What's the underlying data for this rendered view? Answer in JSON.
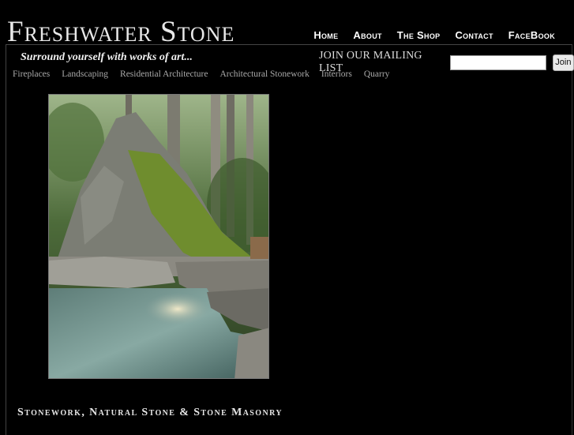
{
  "site": {
    "logo": "Freshwater Stone",
    "tagline": "Surround yourself with works of art..."
  },
  "top_nav": [
    "Home",
    "About",
    "The Shop",
    "Contact",
    "FaceBook"
  ],
  "mailing": {
    "label": "JOIN OUR MAILING LIST",
    "input_value": "",
    "button": "Join"
  },
  "sub_nav": [
    "Fireplaces",
    "Landscaping",
    "Residential Architecture",
    "Architectural Stonework",
    "Interiors",
    "Quarry"
  ],
  "footer": {
    "title": "Stonework, Natural Stone & Stone Masonry"
  },
  "colors": {
    "background": "#000000",
    "text": "#dddddd",
    "subnav": "#a9a9a9"
  }
}
